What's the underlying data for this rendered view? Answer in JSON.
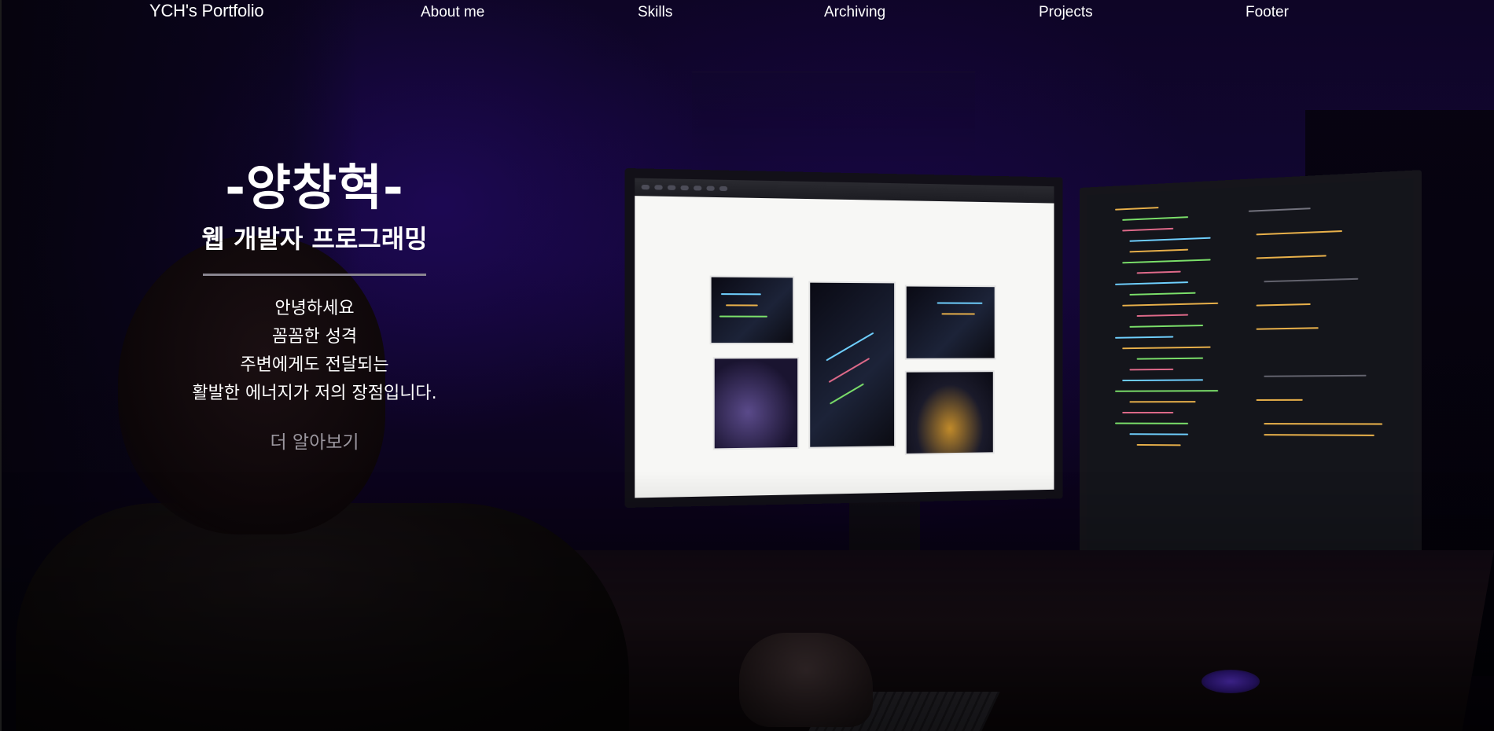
{
  "nav": {
    "logo": "YCH's Portfolio",
    "links": [
      "About me",
      "Skills",
      "Archiving",
      "Projects",
      "Footer"
    ]
  },
  "hero": {
    "name": "-양창혁-",
    "role": "웹 개발자 프로그래밍",
    "intro_lines": [
      "안녕하세요",
      "꼼꼼한 성격",
      "주변에게도 전달되는",
      "활발한 에너지가 저의 장점입니다."
    ],
    "more_label": "더 알아보기"
  },
  "colors": {
    "background": "#120634",
    "text": "#ffffff",
    "muted_link": "#9b979f",
    "divider": "#8a8690"
  },
  "background_image": "dark room with person coding at two monitors"
}
